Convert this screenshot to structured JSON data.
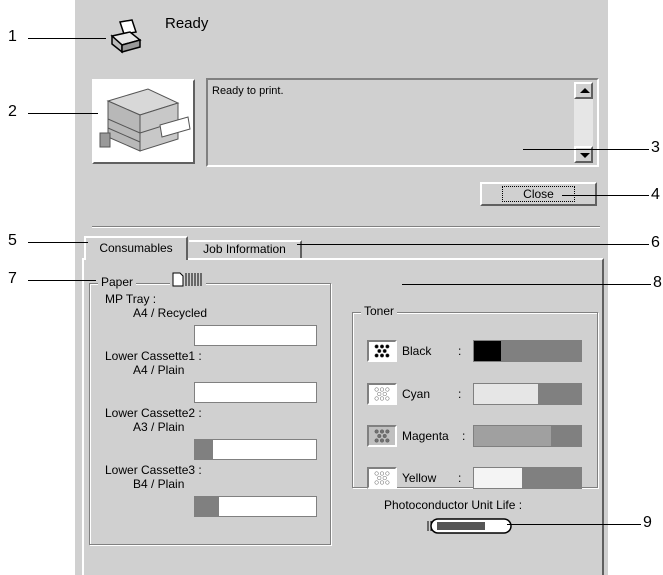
{
  "status": {
    "title": "Ready",
    "message": "Ready to print."
  },
  "buttons": {
    "close_label": "Close"
  },
  "tabs": [
    {
      "label": "Consumables"
    },
    {
      "label": "Job Information"
    }
  ],
  "paper": {
    "group_label": "Paper",
    "items": [
      {
        "name": "MP Tray :",
        "size": "A4 / Recycled",
        "level": 0.0
      },
      {
        "name": "Lower Cassette1 :",
        "size": "A4 / Plain",
        "level": 0.0
      },
      {
        "name": "Lower Cassette2 :",
        "size": "A3 / Plain",
        "level": 0.15
      },
      {
        "name": "Lower Cassette3 :",
        "size": "B4 / Plain",
        "level": 0.2
      }
    ]
  },
  "toner": {
    "group_label": "Toner",
    "items": [
      {
        "name": "Black",
        "colon": ":",
        "level": 0.25,
        "color": "#000000"
      },
      {
        "name": "Cyan",
        "colon": ":",
        "level": 0.6,
        "color": "#e6e6e6"
      },
      {
        "name": "Magenta",
        "colon": ":",
        "level": 0.72,
        "color": "#a0a0a0"
      },
      {
        "name": "Yellow",
        "colon": ":",
        "level": 0.45,
        "color": "#f4f4f4"
      }
    ]
  },
  "photoconductor": {
    "label": "Photoconductor Unit Life :",
    "level": 0.7
  },
  "callouts": [
    "1",
    "2",
    "3",
    "4",
    "5",
    "6",
    "7",
    "8",
    "9"
  ]
}
